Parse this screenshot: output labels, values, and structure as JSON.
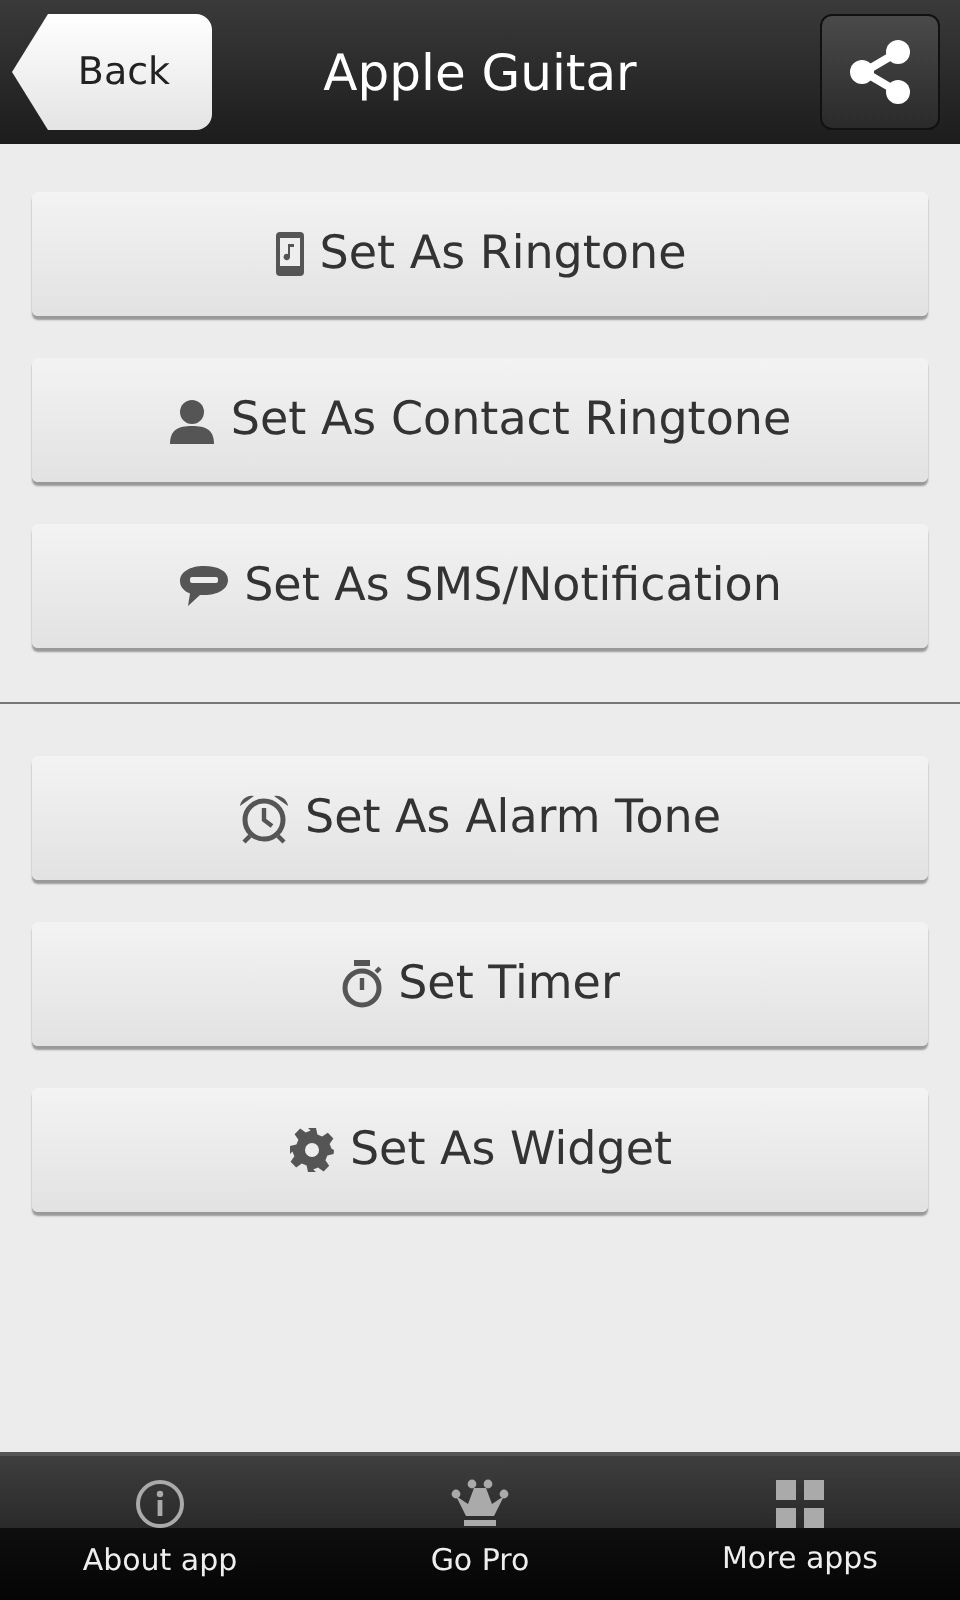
{
  "header": {
    "back": "Back",
    "title": "Apple Guitar"
  },
  "groups": [
    {
      "buttons": [
        {
          "label": "Set As Ringtone"
        },
        {
          "label": "Set As Contact Ringtone"
        },
        {
          "label": "Set As SMS/Notification"
        }
      ]
    },
    {
      "buttons": [
        {
          "label": "Set As Alarm Tone"
        },
        {
          "label": "Set Timer"
        },
        {
          "label": "Set As Widget"
        }
      ]
    }
  ],
  "bottom_bar": [
    {
      "label": "About app"
    },
    {
      "label": "Go Pro"
    },
    {
      "label": "More apps"
    }
  ]
}
